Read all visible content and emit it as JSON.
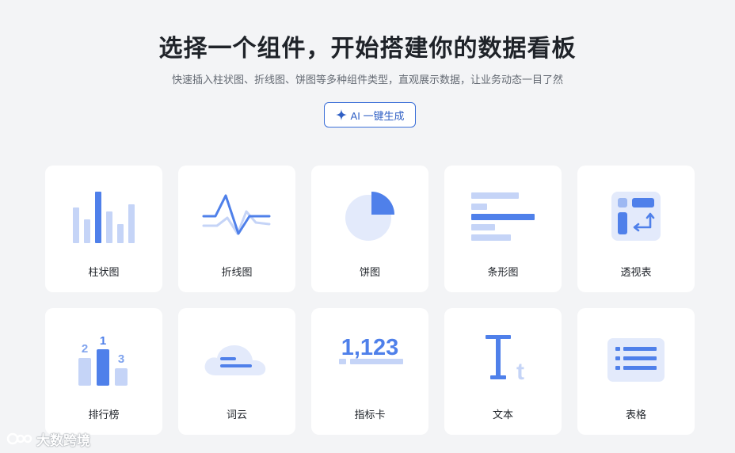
{
  "header": {
    "title": "选择一个组件，开始搭建你的数据看板",
    "subtitle": "快速插入柱状图、折线图、饼图等多种组件类型，直观展示数据，让业务动态一目了然",
    "ai_button_label": "AI 一键生成"
  },
  "components": [
    {
      "label": "柱状图",
      "icon": "bar-chart-icon"
    },
    {
      "label": "折线图",
      "icon": "line-chart-icon"
    },
    {
      "label": "饼图",
      "icon": "pie-chart-icon"
    },
    {
      "label": "条形图",
      "icon": "horizontal-bar-chart-icon"
    },
    {
      "label": "透视表",
      "icon": "pivot-table-icon"
    },
    {
      "label": "排行榜",
      "icon": "leaderboard-icon"
    },
    {
      "label": "词云",
      "icon": "word-cloud-icon"
    },
    {
      "label": "指标卡",
      "icon": "metric-card-icon"
    },
    {
      "label": "文本",
      "icon": "text-icon"
    },
    {
      "label": "表格",
      "icon": "table-icon"
    }
  ],
  "icon_text": {
    "rank_first": "1",
    "rank_second": "2",
    "rank_third": "3",
    "metric_value": "1,123",
    "text_big": "T",
    "text_small": "t"
  },
  "watermark": {
    "text": "大数跨境"
  },
  "colors": {
    "accent": "#4f80ea",
    "accent_light": "#c5d4f7",
    "accent_pale": "#e3eafb",
    "background": "#f3f4f6",
    "card": "#ffffff"
  }
}
